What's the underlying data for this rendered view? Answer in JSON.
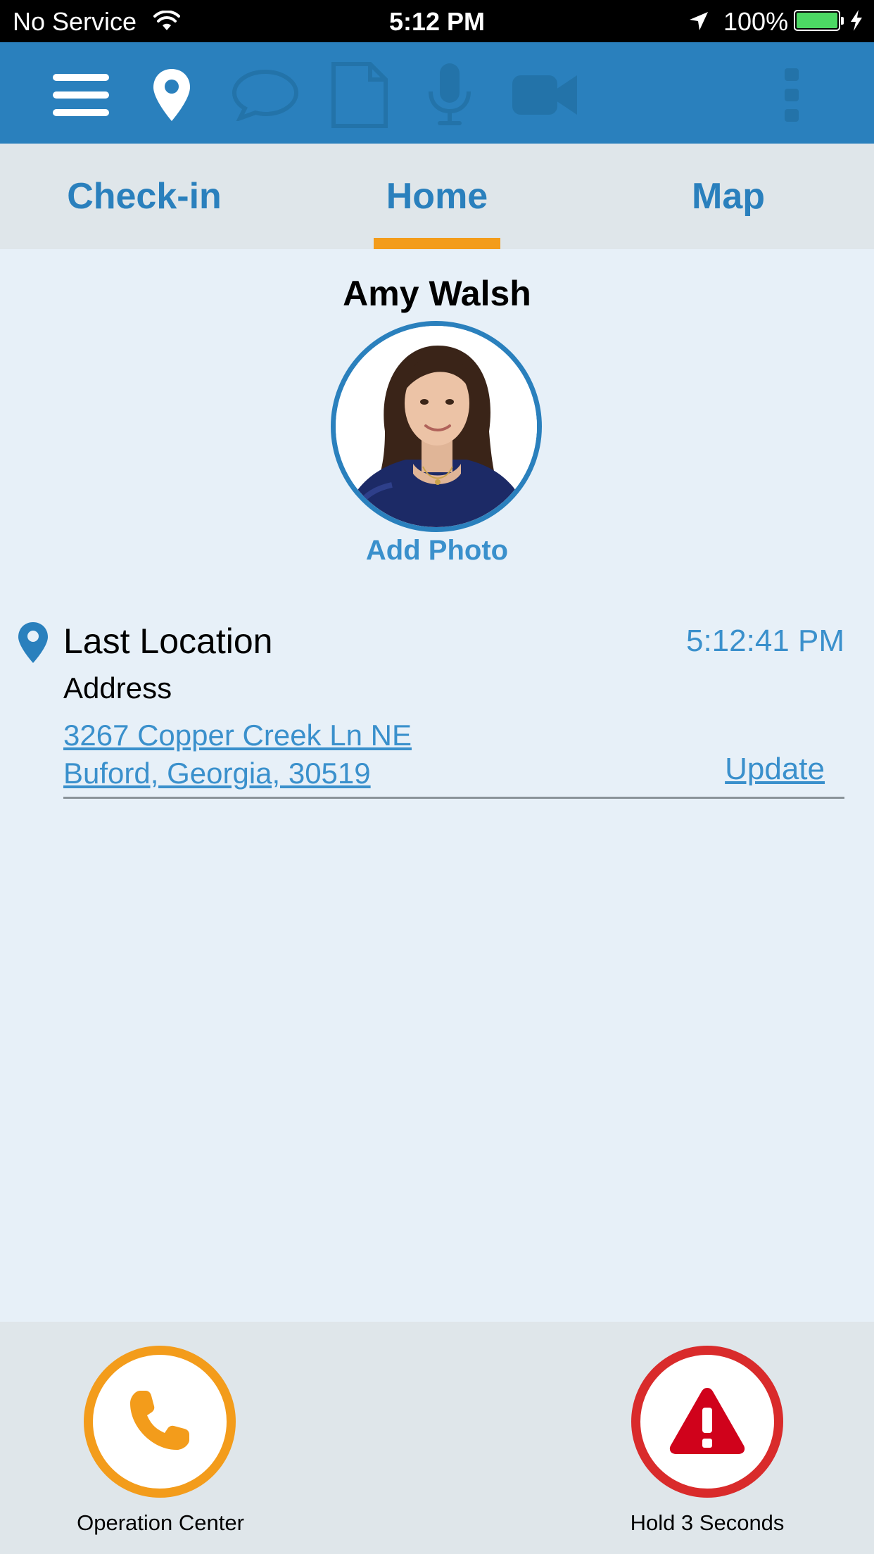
{
  "status_bar": {
    "carrier": "No Service",
    "time": "5:12 PM",
    "battery": "100%"
  },
  "toolbar": {
    "icons": [
      "menu-icon",
      "location-pin-icon",
      "chat-bubble-icon",
      "document-icon",
      "microphone-icon",
      "video-camera-icon",
      "more-vertical-icon"
    ],
    "active_color": "#ffffff",
    "inactive_color": "#2373a9"
  },
  "tabs": [
    {
      "label": "Check-in"
    },
    {
      "label": "Home",
      "active": true
    },
    {
      "label": "Map"
    }
  ],
  "profile": {
    "name": "Amy Walsh",
    "add_photo": "Add Photo"
  },
  "last_location": {
    "title": "Last Location",
    "time": "5:12:41 PM",
    "address_label": "Address",
    "address_line1": "3267 Copper Creek Ln NE",
    "address_line2": "Buford, Georgia, 30519",
    "update_label": "Update"
  },
  "bottom": {
    "call_label": "Operation Center",
    "sos_label": "Hold 3 Seconds"
  },
  "colors": {
    "brand_blue": "#2a80bd",
    "accent_orange": "#f39c1b",
    "alert_red": "#d92b2b",
    "background": "#e7f0f8"
  }
}
